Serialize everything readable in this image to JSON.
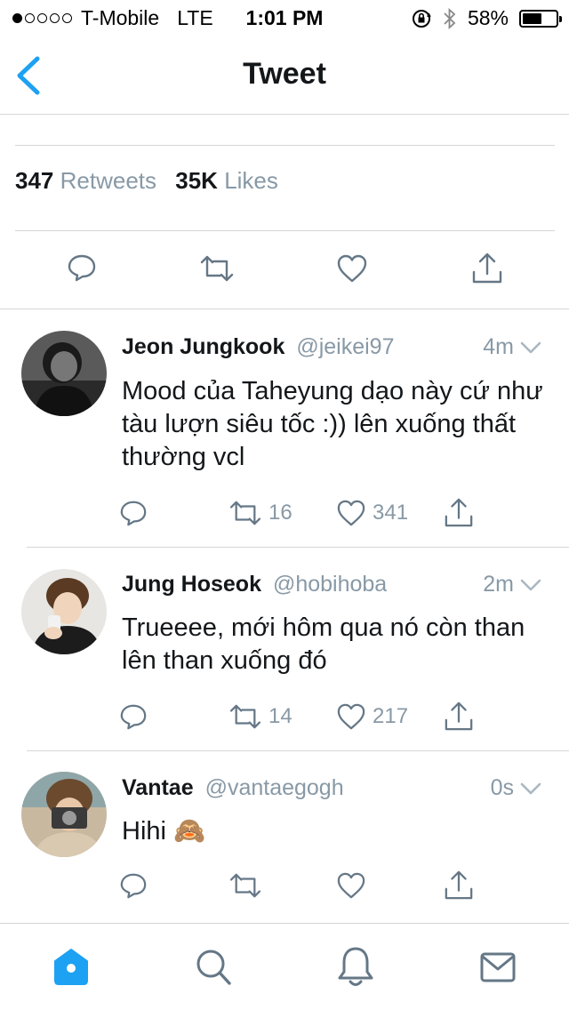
{
  "status_bar": {
    "carrier": "T-Mobile",
    "network": "LTE",
    "time": "1:01 PM",
    "battery": "58%",
    "battery_level": 0.58
  },
  "nav": {
    "title": "Tweet"
  },
  "stats": {
    "retweets_count": "347",
    "retweets_label": "Retweets",
    "likes_count": "35K",
    "likes_label": "Likes"
  },
  "replies": [
    {
      "name": "Jeon Jungkook",
      "handle": "@jeikei97",
      "time": "4m",
      "text": "Mood của Taheyung dạo này cứ như tàu lượn siêu tốc :)) lên xuống thất thường vcl",
      "retweets": "16",
      "likes": "341"
    },
    {
      "name": "Jung Hoseok",
      "handle": "@hobihoba",
      "time": "2m",
      "text": "Trueeee, mới hôm qua nó còn than lên than xuống đó",
      "retweets": "14",
      "likes": "217"
    },
    {
      "name": "Vantae",
      "handle": "@vantaegogh",
      "time": "0s",
      "text": "Hihi 🙈",
      "retweets": "",
      "likes": ""
    }
  ],
  "colors": {
    "accent": "#1da1f2",
    "muted": "#8899a6",
    "text": "#14171a",
    "divider": "#d6d6d6"
  },
  "icons": {
    "back": "chevron-left-icon",
    "reply": "reply-icon",
    "retweet": "retweet-icon",
    "like": "heart-icon",
    "share": "share-icon",
    "home": "home-icon",
    "search": "search-icon",
    "notifications": "bell-icon",
    "messages": "mail-icon"
  }
}
